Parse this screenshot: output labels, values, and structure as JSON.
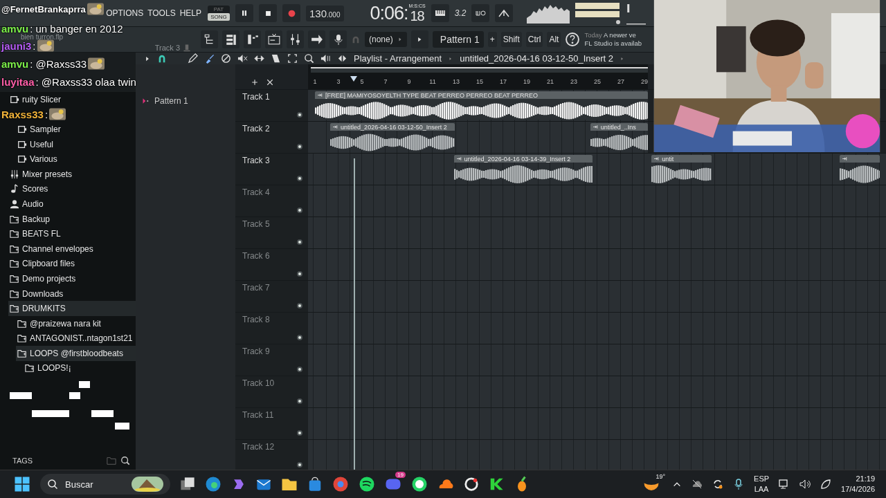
{
  "menu": [
    "OPTIONS",
    "TOOLS",
    "HELP"
  ],
  "transport": {
    "modes": [
      {
        "label": "PAT",
        "selected": false
      },
      {
        "label": "SONG",
        "selected": true
      }
    ],
    "recording": true,
    "tempo": "130",
    "tempo_decimals": ".000",
    "time": "0:06:",
    "time_cs": "18",
    "time_unit": "M:S:CS",
    "snap": "3.2",
    "master_volume": {
      "level": 0.05
    }
  },
  "hint_bar": {
    "file": "bien turron.flp",
    "track": "Track 3"
  },
  "toolbar": {
    "channel": "(none)",
    "pattern": "Pattern 1",
    "add": "+",
    "keys": [
      "Shift",
      "Ctrl",
      "Alt"
    ],
    "news": {
      "date": "Today",
      "line1": "A newer ve",
      "line2": "FL Studio is availab"
    }
  },
  "sidebar": {
    "items": [
      {
        "label": "ruity Slicer",
        "kind": "preset",
        "selected": false
      },
      {
        "kind": "group",
        "children": [
          {
            "label": "Sampler",
            "kind": "preset",
            "selected": false
          },
          {
            "label": "Useful",
            "kind": "preset",
            "selected": false
          },
          {
            "label": "Various",
            "kind": "preset",
            "selected": false
          }
        ]
      },
      {
        "label": "Mixer presets",
        "kind": "mixer",
        "selected": false
      },
      {
        "label": "Scores",
        "kind": "score",
        "selected": false
      },
      {
        "label": "Audio",
        "kind": "audio",
        "selected": false
      },
      {
        "label": "Backup",
        "kind": "folder",
        "selected": false
      },
      {
        "label": "BEATS FL",
        "kind": "folder",
        "selected": false
      },
      {
        "label": "Channel envelopes",
        "kind": "folder",
        "selected": false
      },
      {
        "label": "Clipboard files",
        "kind": "folder",
        "selected": false
      },
      {
        "label": "Demo projects",
        "kind": "folder",
        "selected": false
      },
      {
        "label": "Downloads",
        "kind": "folder",
        "selected": false
      },
      {
        "label": "DRUMKITS",
        "kind": "folder",
        "selected": true,
        "children": [
          {
            "label": "@praizewa nara kit",
            "kind": "folder",
            "selected": false
          },
          {
            "label": "ANTAGONIST..ntagon1st21",
            "kind": "folder",
            "selected": false
          },
          {
            "label": "LOOPS @firstbloodbeats",
            "kind": "folder",
            "selected": true,
            "children": [
              {
                "label": "LOOPS!¡",
                "kind": "folder",
                "selected": false
              }
            ]
          }
        ]
      }
    ],
    "footer": "TAGS"
  },
  "playlist": {
    "title": "Playlist - Arrangement",
    "breadcrumb": "untitled_2026-04-16 03-12-50_Insert 2",
    "ruler": [
      "1",
      "3",
      "5",
      "7",
      "9",
      "11",
      "13",
      "15",
      "17",
      "19",
      "21",
      "23",
      "25",
      "27",
      "29"
    ]
  },
  "pattern_panel": {
    "items": [
      {
        "label": "Pattern 1"
      }
    ]
  },
  "tracks": [
    {
      "name": "Track 1",
      "clips": [
        {
          "label": "[FREE] MAMIYOSOYELTH TYPE BEAT PERREO PERREO BEAT PERREO",
          "color": "#f2f2f2"
        }
      ]
    },
    {
      "name": "Track 2",
      "clips": [
        {
          "label": "untitled_2026-04-16 03-12-50_Insert 2",
          "color": "#b9bdbf"
        },
        {
          "label": "untitled_..Ins",
          "color": "#b9bdbf"
        }
      ]
    },
    {
      "name": "Track 3",
      "clips": [
        {
          "label": "untitled_2026-04-16 03-14-39_Insert 2",
          "color": "#b9bdbf"
        },
        {
          "label": "untit",
          "color": "#b9bdbf"
        },
        {
          "color": "#b9bdbf"
        }
      ]
    },
    {
      "name": "Track 4"
    },
    {
      "name": "Track 5"
    },
    {
      "name": "Track 6"
    },
    {
      "name": "Track 7"
    },
    {
      "name": "Track 8"
    },
    {
      "name": "Track 9"
    },
    {
      "name": "Track 10"
    },
    {
      "name": "Track 11"
    },
    {
      "name": "Track 12"
    }
  ],
  "chat": [
    {
      "user": "@FernetBrankaprra",
      "color": "#ffffff",
      "emote": true
    },
    {
      "user": "amvu",
      "text": ": un banger en 2012",
      "color": "#7df04a",
      "emote": false
    },
    {
      "user": "jauni3",
      "text": ":",
      "color": "#b65cf5",
      "emote": true
    },
    {
      "user": "amvu",
      "text": ": @Raxss33",
      "color": "#7df04a",
      "emote": true
    },
    {
      "user": "luyitaa",
      "text": ": @Raxss33 olaa twin",
      "color": "#ff5fa8",
      "emote": false
    },
    {
      "user": "Raxss33",
      "text": ":",
      "color": "#f2b43a",
      "emote": true
    }
  ],
  "taskbar": {
    "search": "Buscar",
    "badge": "19",
    "weather": "19°",
    "language": [
      "ESP",
      "LAA"
    ],
    "time": "21:19",
    "date": "17/4/2026"
  }
}
